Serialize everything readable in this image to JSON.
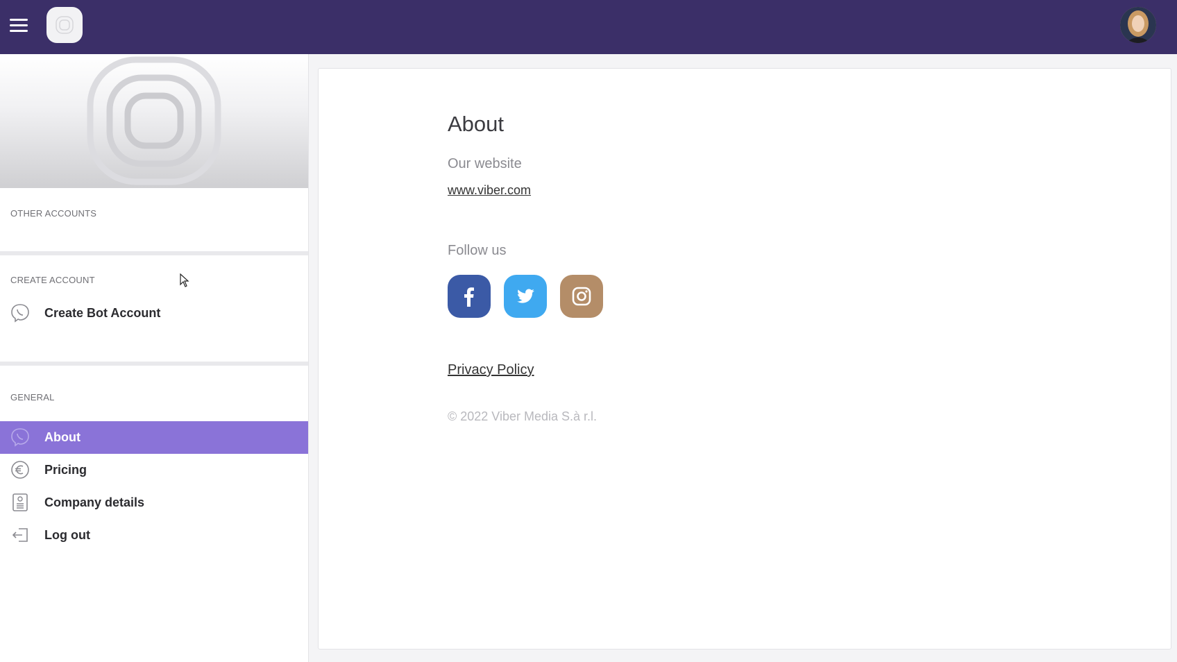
{
  "colors": {
    "topbar": "#3b2f68",
    "active_nav": "#8a73d8",
    "facebook": "#3b5aa6",
    "twitter": "#3fa9f0",
    "instagram": "#b48d68"
  },
  "topbar": {
    "menu_icon": "hamburger-menu-icon",
    "logo_icon": "viber-logo-icon",
    "avatar_icon": "user-avatar"
  },
  "sidebar": {
    "other_accounts_title": "OTHER ACCOUNTS",
    "create_account_title": "CREATE ACCOUNT",
    "create_items": [
      {
        "label": "Create Bot Account",
        "icon": "viber-phone-icon"
      }
    ],
    "general_title": "GENERAL",
    "general_items": [
      {
        "label": "About",
        "icon": "viber-phone-icon",
        "active": true
      },
      {
        "label": "Pricing",
        "icon": "euro-icon",
        "active": false
      },
      {
        "label": "Company details",
        "icon": "document-icon",
        "active": false
      },
      {
        "label": "Log out",
        "icon": "logout-icon",
        "active": false
      }
    ]
  },
  "main": {
    "title": "About",
    "website_label": "Our website",
    "website_link": "www.viber.com",
    "follow_label": "Follow us",
    "social": [
      {
        "name": "facebook",
        "icon": "facebook-icon"
      },
      {
        "name": "twitter",
        "icon": "twitter-icon"
      },
      {
        "name": "instagram",
        "icon": "instagram-icon"
      }
    ],
    "privacy_link": "Privacy Policy",
    "copyright": "© 2022 Viber Media S.à r.l."
  }
}
